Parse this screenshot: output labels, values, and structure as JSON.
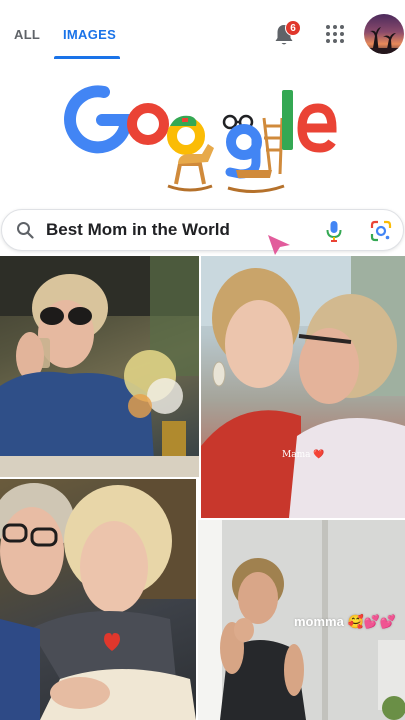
{
  "tabs": [
    {
      "label": "ALL",
      "active": false
    },
    {
      "label": "IMAGES",
      "active": true
    }
  ],
  "notifications": {
    "count": "6",
    "icon": "bell-icon"
  },
  "apps_icon": "apps-grid-icon",
  "doodle": {
    "letters": [
      "G",
      "o",
      "o",
      "g",
      "l",
      "e"
    ]
  },
  "search": {
    "query": "Best Mom in the World",
    "icons": [
      "search-icon",
      "mic-icon",
      "google-lens-icon"
    ]
  },
  "results": [
    {
      "name": "mother-drinking-coffee",
      "caption": ""
    },
    {
      "name": "mother-kissing-daughter",
      "caption": "Mama ❤️"
    },
    {
      "name": "mother-and-daughter-selfie",
      "caption": "❤️"
    },
    {
      "name": "mother-portrait",
      "caption": "momma 🥰💕💕"
    }
  ],
  "colors": {
    "accent": "#1a73e8",
    "badge": "#e0372c",
    "google_blue": "#4285f4",
    "google_red": "#ea4335",
    "google_yellow": "#fbbc05",
    "google_green": "#34a853"
  }
}
